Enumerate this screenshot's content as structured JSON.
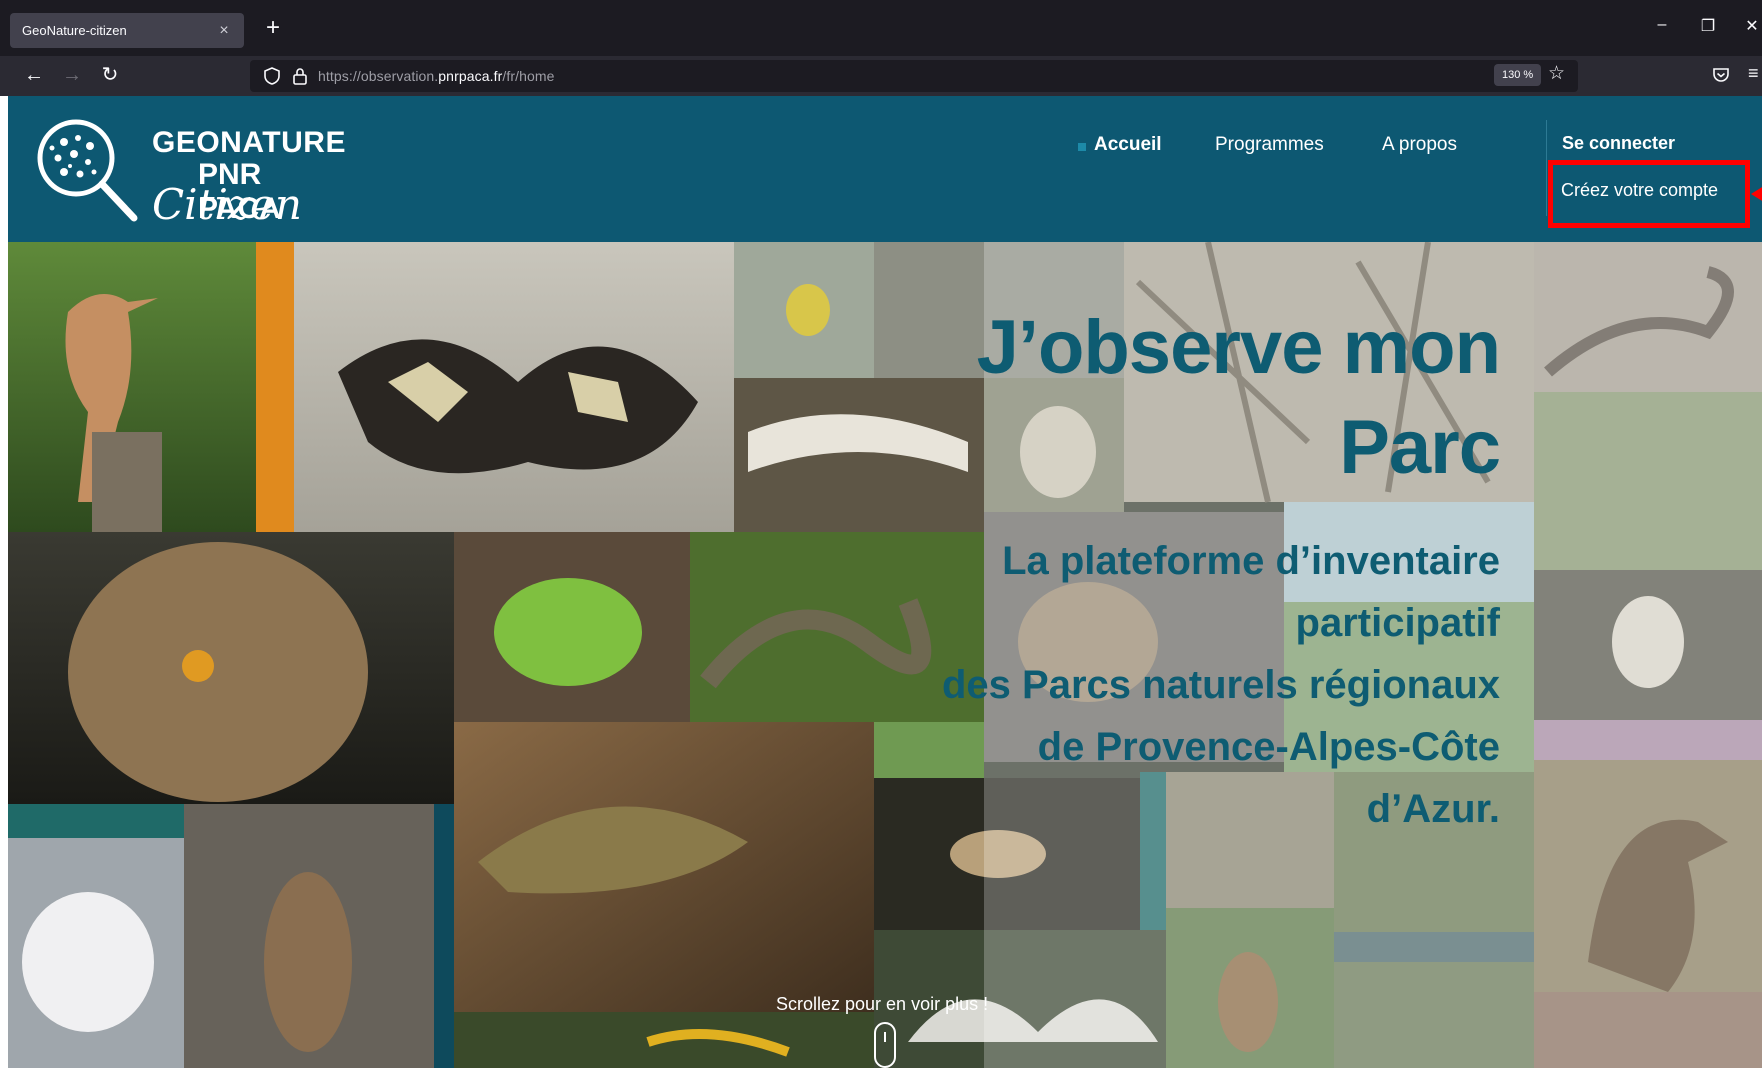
{
  "browser": {
    "tab_title": "GeoNature-citizen",
    "tab_close": "×",
    "new_tab": "+",
    "url_prefix": "https://observation.",
    "url_host": "pnrpaca.fr",
    "url_path": "/fr/home",
    "zoom": "130 %",
    "window_minimize": "–",
    "window_restore": "❐",
    "window_close": "✕",
    "back": "←",
    "forward": "→",
    "reload": "↻",
    "bookmark": "☆",
    "app_menu": "≡"
  },
  "site": {
    "logo": {
      "line1": "GEONATURE",
      "line2": "PNR PACA",
      "line3": "Citizen"
    },
    "nav": {
      "home": "Accueil",
      "programs": "Programmes",
      "about": "A propos"
    },
    "auth": {
      "login": "Se connecter",
      "signup": "Créez votre compte"
    },
    "hero": {
      "title_line1": "J’observe mon",
      "title_line2": "Parc",
      "subtitle_line1": "La plateforme d’inventaire",
      "subtitle_line2": "participatif",
      "subtitle_line3": "des Parcs naturels régionaux",
      "subtitle_line4": "de Provence-Alpes-Côte",
      "subtitle_line5": "d’Azur.",
      "scroll_hint": "Scrollez pour en voir plus !"
    }
  },
  "colors": {
    "header_bg": "#0d5872",
    "title_text": "#0e5c72",
    "highlight": "#ff0000",
    "accent_orange": "#e08a1e"
  },
  "icons": [
    "shield-icon",
    "lock-icon",
    "star-icon",
    "pocket-icon",
    "menu-icon",
    "back-icon",
    "forward-icon",
    "reload-icon",
    "magnifier-icon",
    "mouse-scroll-icon"
  ]
}
